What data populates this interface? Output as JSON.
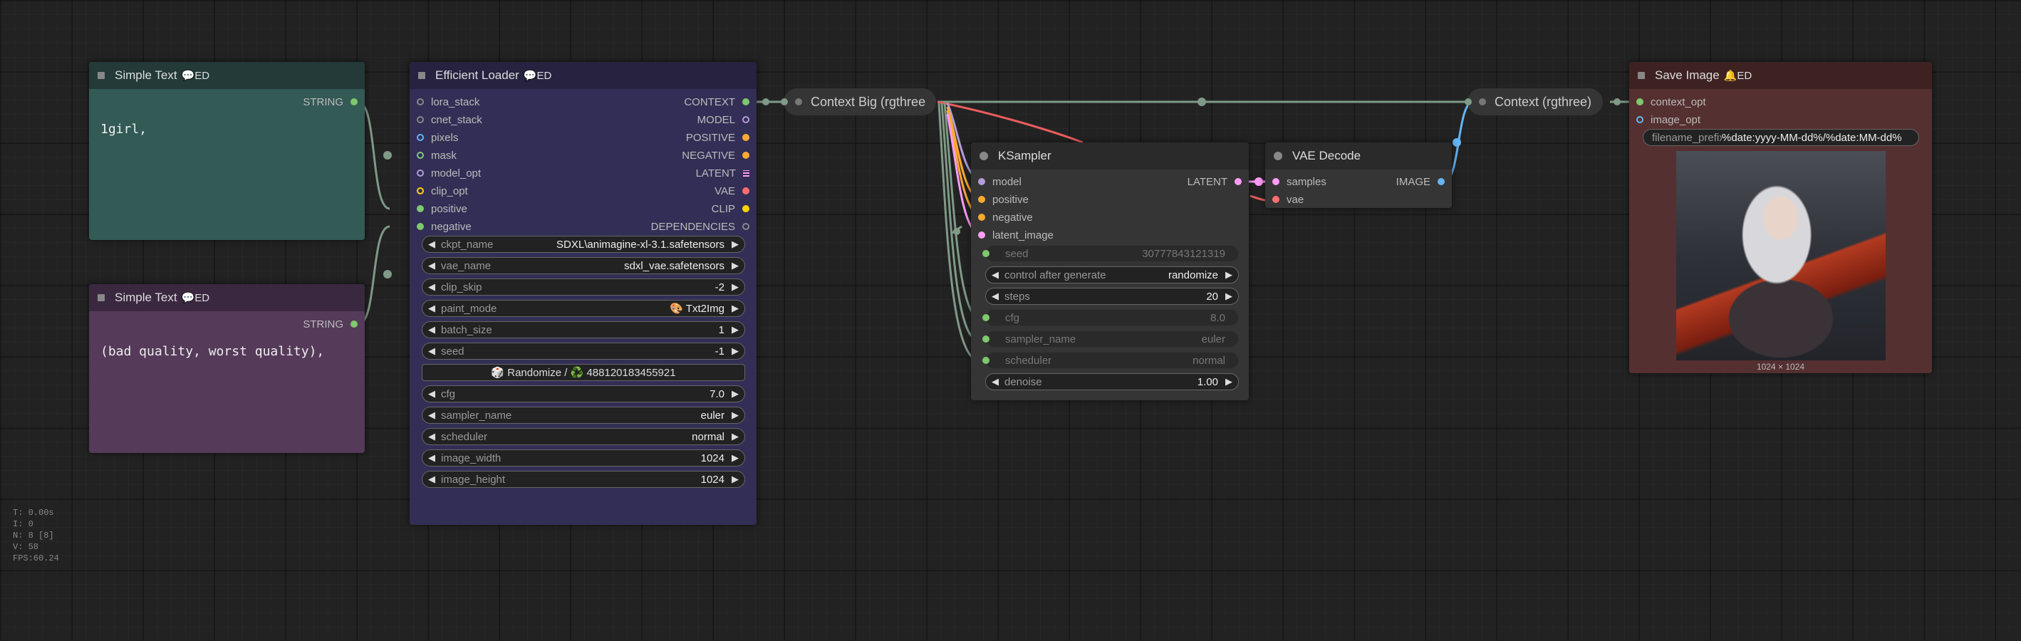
{
  "colors": {
    "string": "#7ec86d",
    "model": "#b39ddb",
    "clip": "#ffd500",
    "vae": "#ff6e6e",
    "conditioning": "#ffa931",
    "latent": "#ff9cf9",
    "image": "#64b5f6",
    "wire": "#7f9a87"
  },
  "simple_text_1": {
    "title": "Simple Text",
    "badge": "💬ED",
    "output": "STRING",
    "text": "1girl,"
  },
  "simple_text_2": {
    "title": "Simple Text",
    "badge": "💬ED",
    "output": "STRING",
    "text": "(bad quality, worst quality),"
  },
  "efficient_loader": {
    "title": "Efficient Loader",
    "badge": "💬ED",
    "inputs": [
      "lora_stack",
      "cnet_stack",
      "pixels",
      "mask",
      "model_opt",
      "clip_opt",
      "positive",
      "negative"
    ],
    "outputs": [
      "CONTEXT",
      "MODEL",
      "POSITIVE",
      "NEGATIVE",
      "LATENT",
      "VAE",
      "CLIP",
      "DEPENDENCIES"
    ],
    "widgets": [
      {
        "label": "ckpt_name",
        "value": "SDXL\\animagine-xl-3.1.safetensors"
      },
      {
        "label": "vae_name",
        "value": "sdxl_vae.safetensors"
      },
      {
        "label": "clip_skip",
        "value": "-2"
      },
      {
        "label": "paint_mode",
        "value": "🎨 Txt2Img"
      },
      {
        "label": "batch_size",
        "value": "1"
      },
      {
        "label": "seed",
        "value": "-1"
      }
    ],
    "randomize_button": "🎲 Randomize / ♻️ 488120183455921",
    "widgets2": [
      {
        "label": "cfg",
        "value": "7.0"
      },
      {
        "label": "sampler_name",
        "value": "euler"
      },
      {
        "label": "scheduler",
        "value": "normal"
      },
      {
        "label": "image_width",
        "value": "1024"
      },
      {
        "label": "image_height",
        "value": "1024"
      }
    ]
  },
  "context_big": {
    "title": "Context Big (rgthree"
  },
  "context": {
    "title": "Context (rgthree)"
  },
  "ksampler": {
    "title": "KSampler",
    "inputs": [
      "model",
      "positive",
      "negative",
      "latent_image"
    ],
    "output": "LATENT",
    "widgets": [
      {
        "label": "seed",
        "value": "30777843121319",
        "disabled": true
      },
      {
        "label": "control after generate",
        "value": "randomize",
        "disabled": false
      },
      {
        "label": "steps",
        "value": "20",
        "disabled": false
      },
      {
        "label": "cfg",
        "value": "8.0",
        "disabled": true
      },
      {
        "label": "sampler_name",
        "value": "euler",
        "disabled": true
      },
      {
        "label": "scheduler",
        "value": "normal",
        "disabled": true
      },
      {
        "label": "denoise",
        "value": "1.00",
        "disabled": false
      }
    ]
  },
  "vae_decode": {
    "title": "VAE Decode",
    "inputs": [
      "samples",
      "vae"
    ],
    "output": "IMAGE"
  },
  "save_image": {
    "title": "Save Image",
    "badge": "🔔ED",
    "inputs": [
      "context_opt",
      "image_opt"
    ],
    "filename_label": "filename_prefix",
    "filename_value": "%date:yyyy-MM-dd%/%date:MM-dd%",
    "image_size": "1024 × 1024"
  },
  "stats": [
    "T: 0.00s",
    "I: 0",
    "N: 8 [8]",
    "V: 58",
    "FPS:60.24"
  ]
}
